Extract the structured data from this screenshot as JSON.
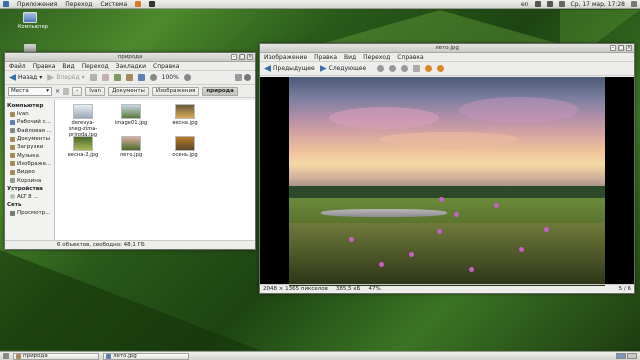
{
  "topbar": {
    "menu": [
      "Приложения",
      "Переход",
      "Система"
    ],
    "lang": "en",
    "datetime": "Ср, 17 мар, 17:28"
  },
  "desktop": {
    "icon_label": "Компьютер"
  },
  "file_manager": {
    "title": "природа",
    "menu": [
      "Файл",
      "Правка",
      "Вид",
      "Переход",
      "Закладки",
      "Справка"
    ],
    "toolbar": {
      "back": "Назад",
      "forward": "Вперёд",
      "zoom": "100%"
    },
    "places_select": "Места",
    "breadcrumbs": [
      "Ivan",
      "Документы",
      "Изображения",
      "природа"
    ],
    "sidebar": {
      "computer_header": "Компьютер",
      "computer_items": [
        "Ivan",
        "Рабочий с...",
        "Файловая ...",
        "Документы",
        "Загрузки",
        "Музыка",
        "Изображе...",
        "Видео",
        "Корзина"
      ],
      "devices_header": "Устройства",
      "devices_items": [
        "ALT 8 ..."
      ],
      "network_header": "Сеть",
      "network_items": [
        "Просмотр..."
      ]
    },
    "files": [
      {
        "name": "derevya-sneg-zima-priroda.jpg"
      },
      {
        "name": "image01.jpg"
      },
      {
        "name": "весна.jpg"
      },
      {
        "name": "весна-2.jpg"
      },
      {
        "name": "лето.jpg"
      },
      {
        "name": "осень.jpg"
      }
    ],
    "status": "6 объектов, свободно: 48,1 ГБ"
  },
  "image_viewer": {
    "title": "лето.jpg",
    "menu": [
      "Изображение",
      "Правка",
      "Вид",
      "Переход",
      "Справка"
    ],
    "toolbar": {
      "prev": "Предыдущее",
      "next": "Следующее"
    },
    "status": {
      "dimensions": "2048 × 1365 пикселов",
      "size": "385,5 кБ",
      "zoom": "47%",
      "position": "5 / 6"
    }
  },
  "taskbar": {
    "tasks": [
      "природа",
      "лето.jpg"
    ]
  },
  "colors": {
    "desktop_green": "#2f5f1f",
    "selection": "#c3c3bf",
    "flower": "#c860c8"
  }
}
